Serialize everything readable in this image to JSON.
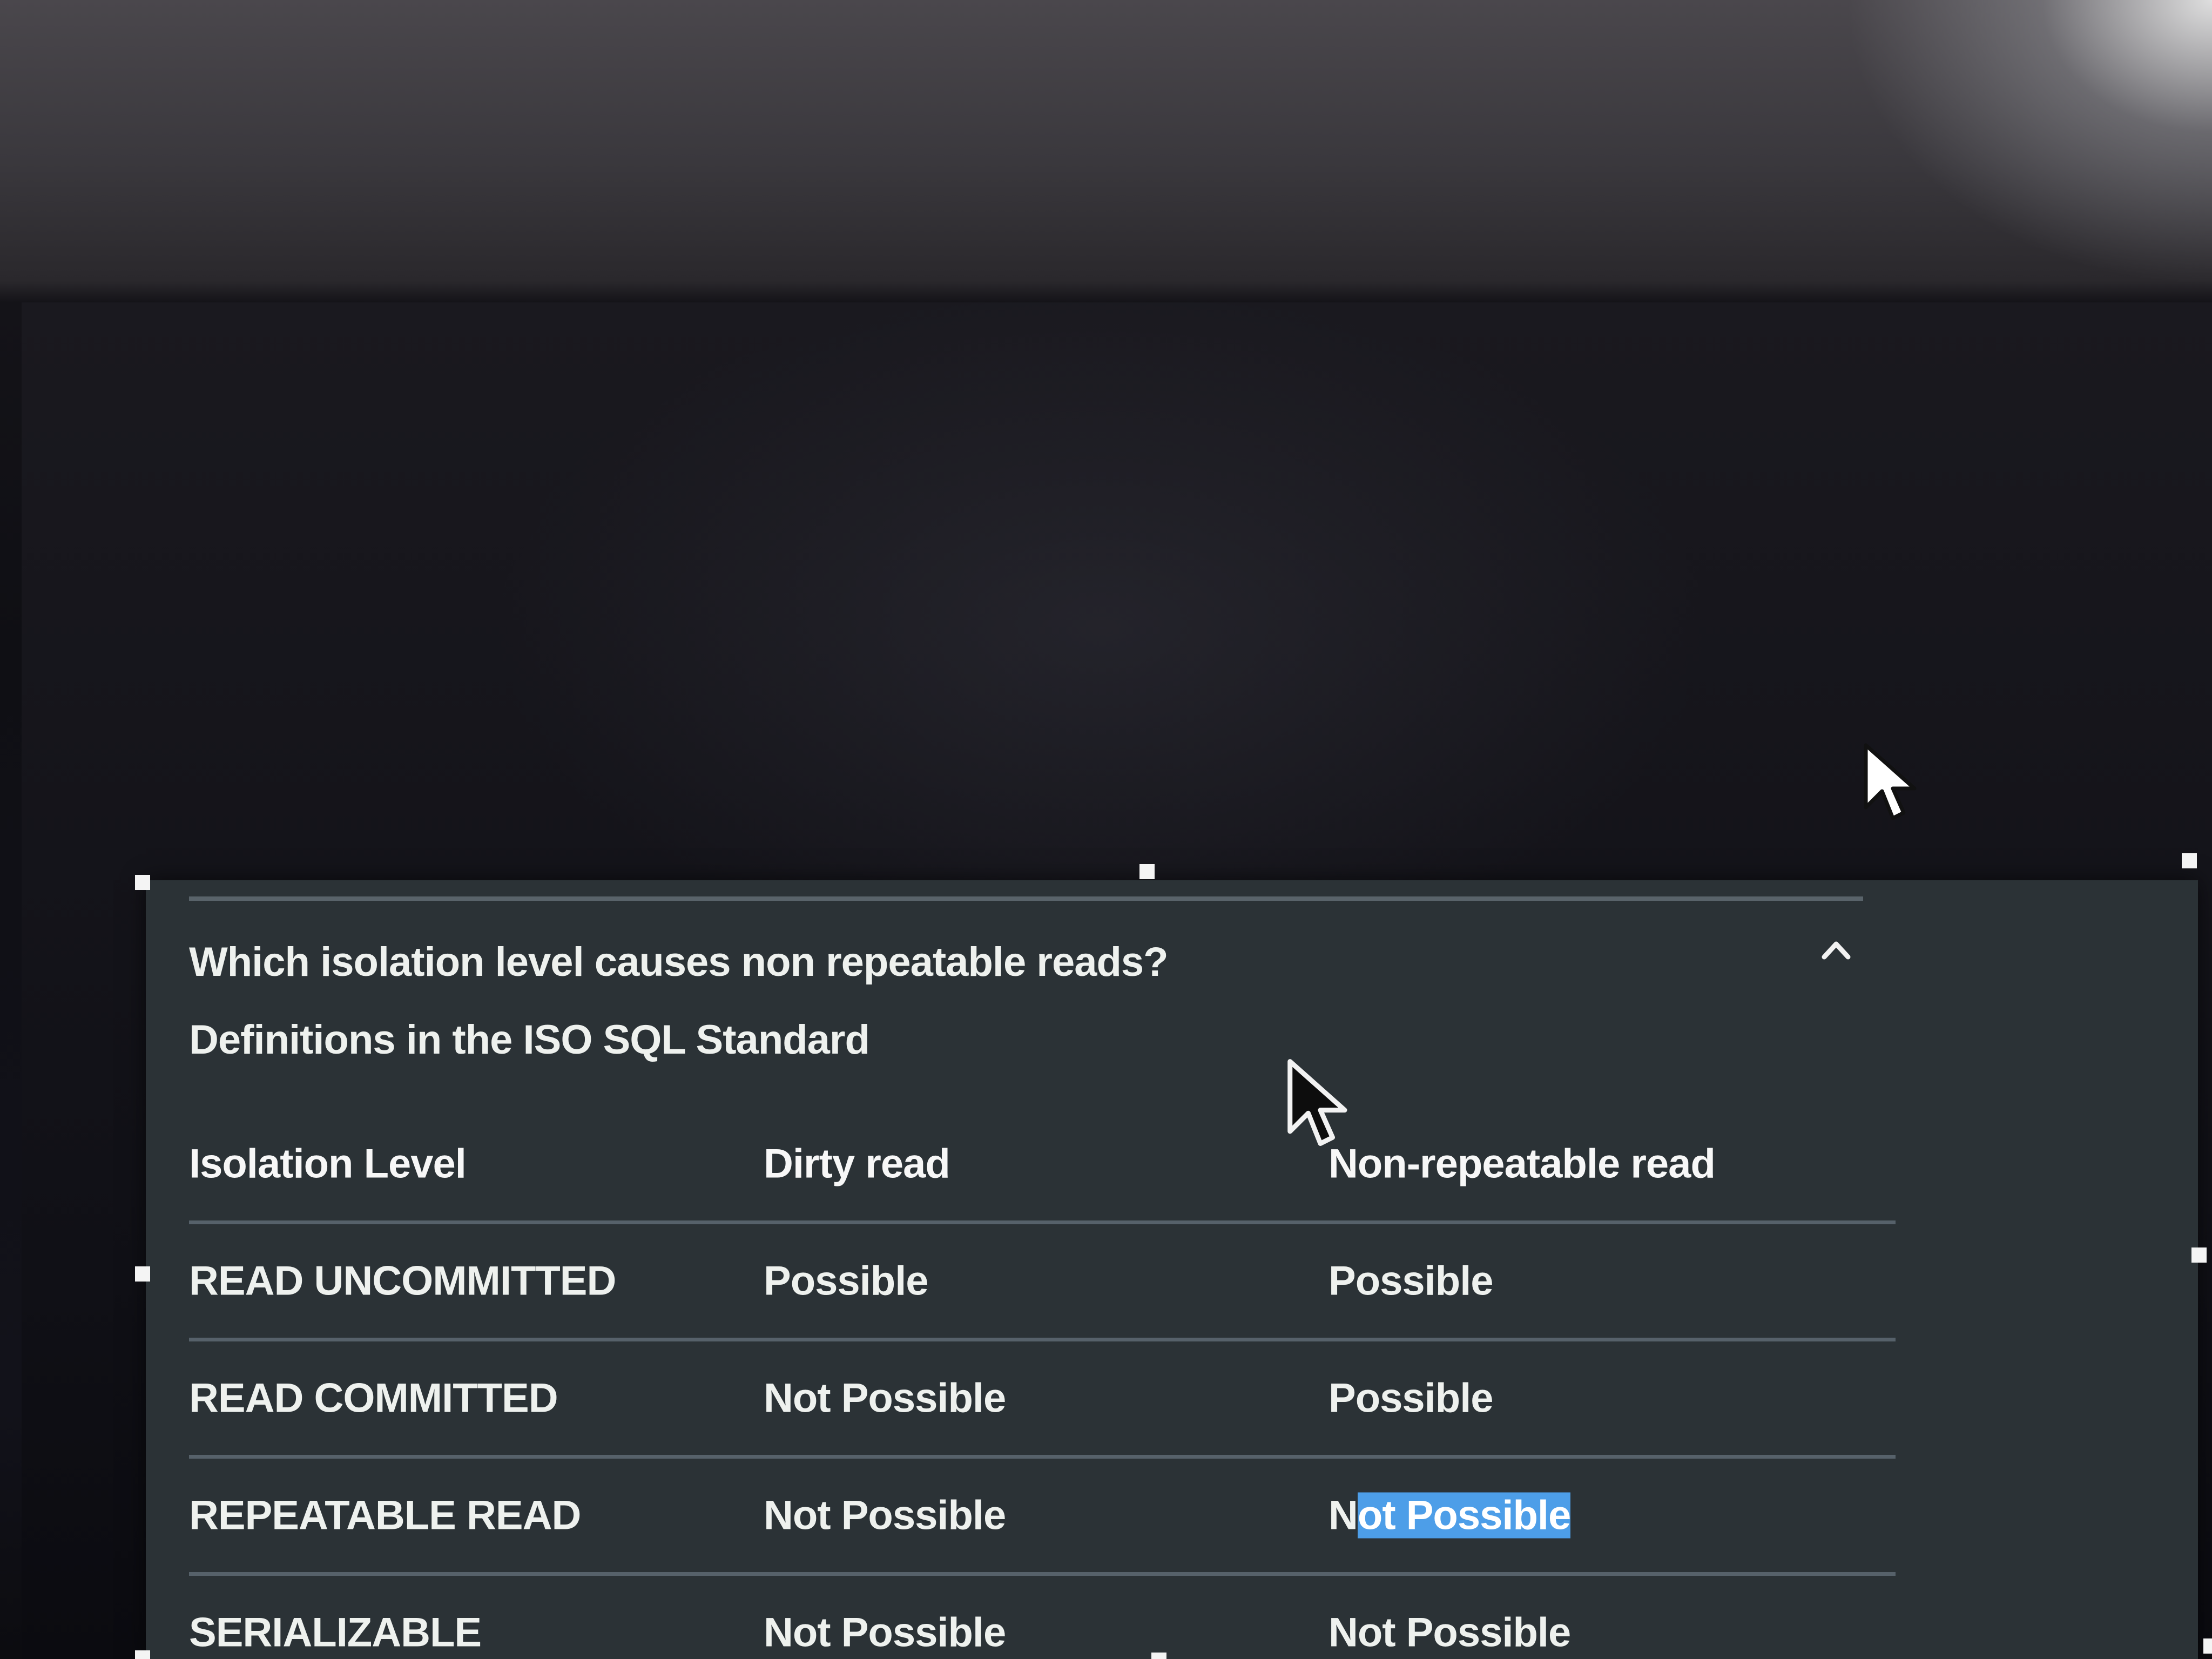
{
  "faq": {
    "question": "Which isolation level causes non repeatable reads?",
    "collapse_icon": "chevron-up-icon",
    "subtitle": "Definitions in the ISO SQL Standard"
  },
  "table": {
    "headers": [
      "Isolation Level",
      "Dirty read",
      "Non-repeatable read"
    ],
    "rows": [
      {
        "level": "READ UNCOMMITTED",
        "dirty_read": "Possible",
        "non_repeatable_read": "Possible"
      },
      {
        "level": "READ COMMITTED",
        "dirty_read": "Not Possible",
        "non_repeatable_read": "Possible"
      },
      {
        "level": "REPEATABLE READ",
        "dirty_read": "Not Possible",
        "non_repeatable_read_prefix": "N",
        "non_repeatable_read_selected": "ot Possible"
      },
      {
        "level": "SERIALIZABLE",
        "dirty_read": "Not Possible",
        "non_repeatable_read": "Not Possible"
      }
    ]
  },
  "colors": {
    "panel_background": "#2b3236",
    "text": "#eef1ee",
    "divider": "#56616a",
    "selection_highlight": "#4d9ee8"
  },
  "cursors": [
    "arrow-cursor-icon",
    "arrow-cursor-icon"
  ]
}
